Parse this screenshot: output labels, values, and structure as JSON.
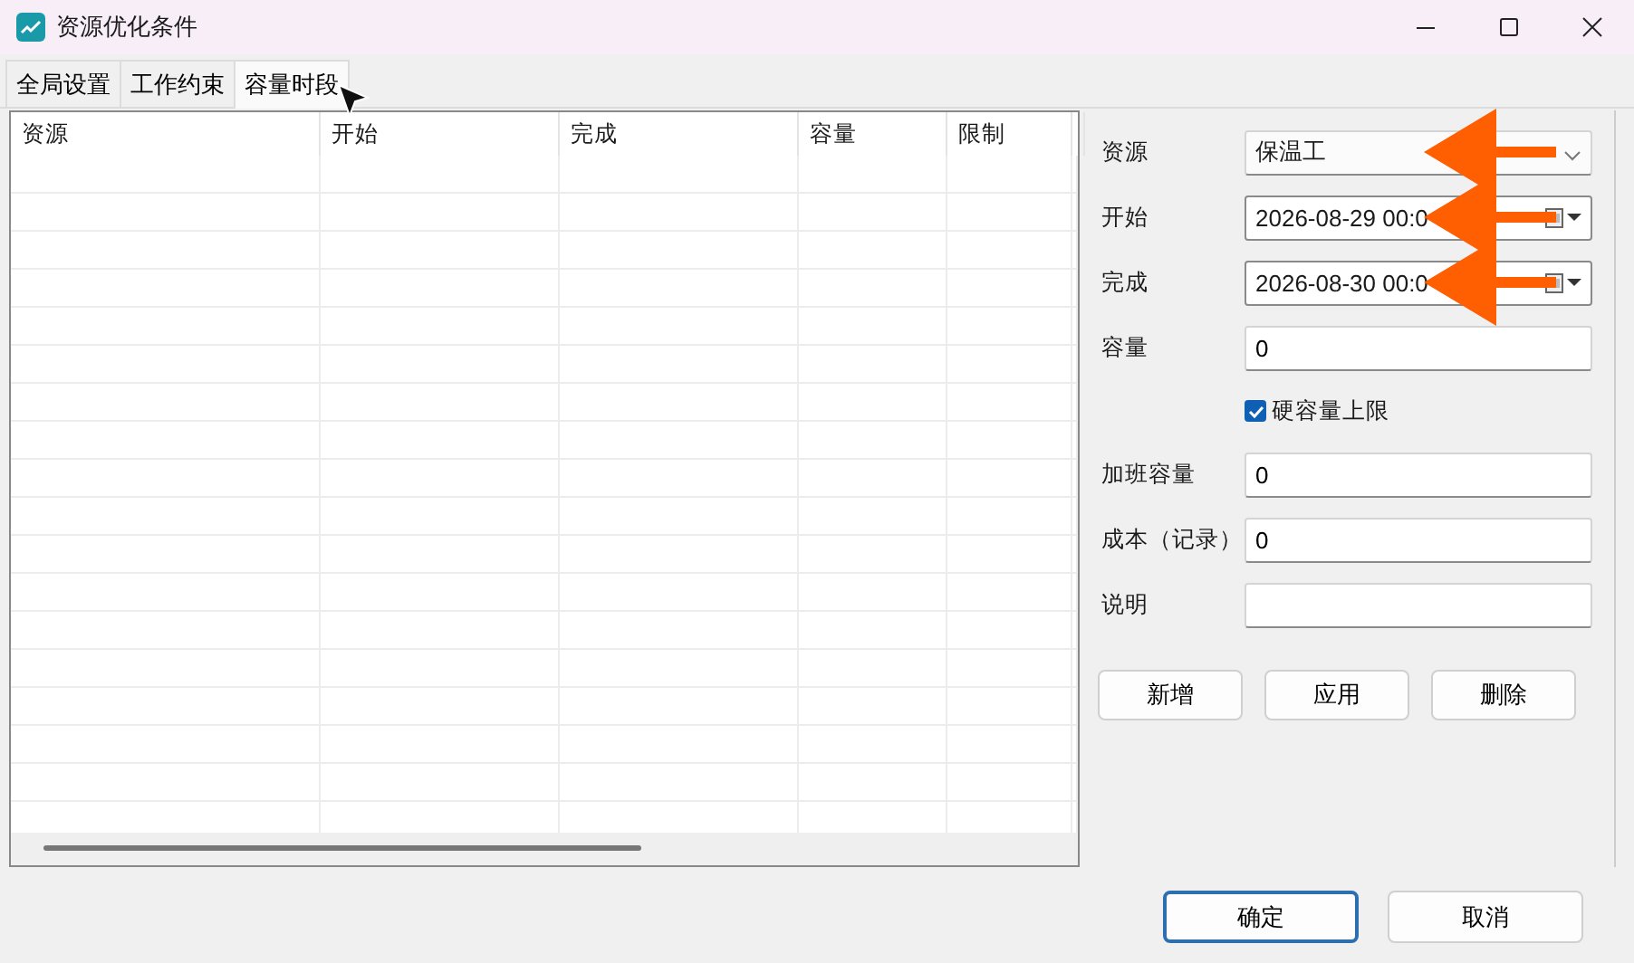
{
  "window": {
    "title": "资源优化条件"
  },
  "tabs": [
    {
      "label": "全局设置",
      "selected": false
    },
    {
      "label": "工作约束",
      "selected": false
    },
    {
      "label": "容量时段",
      "selected": true
    }
  ],
  "table": {
    "columns": [
      "资源",
      "开始",
      "完成",
      "容量",
      "限制"
    ]
  },
  "form": {
    "rows": [
      {
        "kind": "combo",
        "label": "资源",
        "value": "保温工",
        "arrow": true
      },
      {
        "kind": "date",
        "label": "开始",
        "value": "2026-08-29 00:0",
        "arrow": true
      },
      {
        "kind": "date",
        "label": "完成",
        "value": "2026-08-30 00:0",
        "arrow": true
      },
      {
        "kind": "text",
        "label": "容量",
        "value": "0",
        "arrow": false
      },
      {
        "kind": "check",
        "label": "硬容量上限",
        "checked": true,
        "arrow": false
      },
      {
        "kind": "text",
        "label": "加班容量",
        "value": "0",
        "arrow": false
      },
      {
        "kind": "text",
        "label": "成本（记录）",
        "value": "0",
        "arrow": false
      },
      {
        "kind": "text",
        "label": "说明",
        "value": "",
        "arrow": false
      }
    ],
    "buttons": [
      "新增",
      "应用",
      "删除"
    ]
  },
  "footer": {
    "buttons": [
      {
        "label": "确定",
        "default": true
      },
      {
        "label": "取消",
        "default": false
      }
    ]
  }
}
